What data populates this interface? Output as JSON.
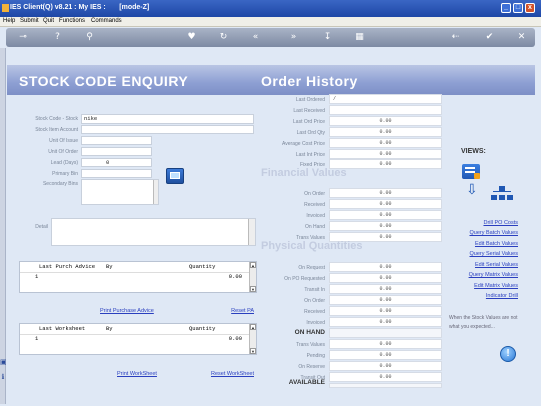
{
  "window": {
    "title": "IES Client(Q) v8.21 : My IES :       [mode-Z]",
    "min": "_",
    "max": "□",
    "close": "x"
  },
  "menu": [
    "Help",
    "Submit",
    "Quit",
    "Functions",
    "Commands"
  ],
  "header": {
    "left_title": "STOCK   CODE   ENQUIRY",
    "right_title": "Order History"
  },
  "stock_form": {
    "fields": [
      {
        "label": "Stock Code - Stock",
        "value": "nike"
      },
      {
        "label": "Stock Item Account",
        "value": ""
      },
      {
        "label": "Unit Of Issue",
        "value": ""
      },
      {
        "label": "Unit Of Order",
        "value": ""
      },
      {
        "label": "Lead (Days)",
        "value": "0"
      },
      {
        "label": "Primary Bin",
        "value": ""
      },
      {
        "label": "Secondary Bins",
        "value": ""
      }
    ],
    "detail_label": "Detail"
  },
  "order_history": [
    {
      "label": "Last Ordered",
      "value": "/"
    },
    {
      "label": "Last Received",
      "value": ""
    },
    {
      "label": "Last Ord Price",
      "value": "0.00"
    },
    {
      "label": "Last Ord Qty",
      "value": "0.00"
    },
    {
      "label": "Average Cost Price",
      "value": "0.00"
    },
    {
      "label": "Last Int Price",
      "value": "0.00"
    },
    {
      "label": "Fixed Price",
      "value": "0.00"
    }
  ],
  "financial": {
    "title": "Financial Values",
    "rows": [
      {
        "label": "On Order",
        "value": "0.00"
      },
      {
        "label": "Received",
        "value": "0.00"
      },
      {
        "label": "Invoiced",
        "value": "0.00"
      },
      {
        "label": "On Hand",
        "value": "0.00"
      },
      {
        "label": "Trans Values",
        "value": "0.00"
      }
    ]
  },
  "physical": {
    "title": "Physical Quantities",
    "rows": [
      {
        "label": "On Request",
        "value": "0.00"
      },
      {
        "label": "On PO Requested",
        "value": "0.00"
      },
      {
        "label": "Transit In",
        "value": "0.00"
      },
      {
        "label": "On Order",
        "value": "0.00"
      },
      {
        "label": "Received",
        "value": "0.00"
      },
      {
        "label": "Invoiced",
        "value": "0.00"
      }
    ],
    "on_hand_label": "ON HAND",
    "rows2": [
      {
        "label": "Trans Values",
        "value": "0.00"
      },
      {
        "label": "Pending",
        "value": "0.00"
      },
      {
        "label": "On Reserve",
        "value": "0.00"
      },
      {
        "label": "Transit Out",
        "value": "0.00"
      }
    ],
    "available_label": "AVAILABLE"
  },
  "purch_grid": {
    "col1": "Last Purch Advice",
    "col2": "By",
    "col3": "Quantity",
    "row_num": "1",
    "row_qty": "0.00"
  },
  "purch_links": {
    "print": "Print Purchase Advice",
    "reset": "Reset PA"
  },
  "ws_grid": {
    "col1": "Last Worksheet",
    "col2": "By",
    "col3": "Quantity",
    "row_num": "1",
    "row_qty": "0.00"
  },
  "ws_links": {
    "print": "Print WorkSheet",
    "reset": "Reset WorkSheet"
  },
  "views": {
    "title": "VIEWS:",
    "links": [
      "Drill PO Costs",
      "Query Batch Values",
      "Edit Batch Values",
      "Query Serial Values",
      "Edit Serial Values",
      "Query Matrix Values",
      "Edit Matrix Values",
      "Indicator Drill"
    ],
    "note": "When the Stock Values are not what you expected..."
  }
}
